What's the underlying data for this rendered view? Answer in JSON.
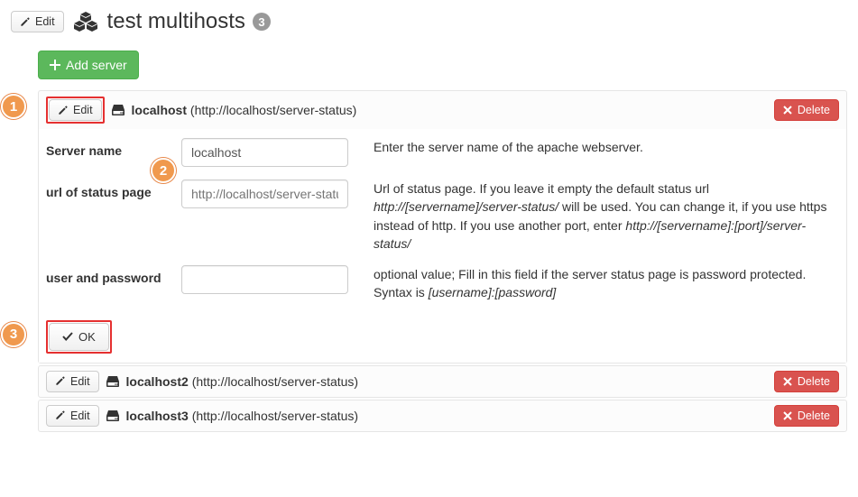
{
  "header": {
    "edit_label": "Edit",
    "title": "test multihosts",
    "count": "3"
  },
  "actions": {
    "add_server": "Add server",
    "edit": "Edit",
    "delete": "Delete",
    "ok": "OK"
  },
  "steps": {
    "s1": "1",
    "s2": "2",
    "s3": "3"
  },
  "server_expanded": {
    "name": "localhost",
    "url": "(http://localhost/server-status)",
    "fields": {
      "server_name": {
        "label": "Server name",
        "value": "localhost",
        "help": "Enter the server name of the apache webserver."
      },
      "status_url": {
        "label": "url of status page",
        "placeholder": "http://localhost/server-status/",
        "help_pre": "Url of status page. If you leave it empty the default status url ",
        "help_em1": "http://[servername]/server-status/",
        "help_mid": " will be used. You can change it, if you use https instead of http. If you use another port, enter ",
        "help_em2": "http://[servername]:[port]/server-status/"
      },
      "userpass": {
        "label": "user and password",
        "help_line1": "optional value; Fill in this field if the server status page is password protected.",
        "help_syntax_pre": "Syntax is ",
        "help_syntax_em": "[username]:[password]"
      }
    }
  },
  "servers": [
    {
      "name": "localhost2",
      "url": "(http://localhost/server-status)"
    },
    {
      "name": "localhost3",
      "url": "(http://localhost/server-status)"
    }
  ]
}
